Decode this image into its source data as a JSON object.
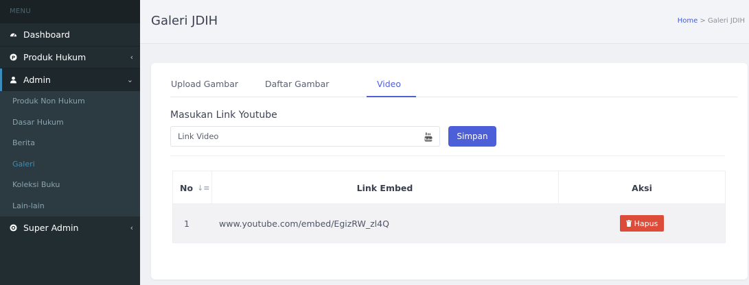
{
  "sidebar": {
    "menu_header": "MENU",
    "items": {
      "dashboard": {
        "label": "Dashboard",
        "icon": "dashboard-icon"
      },
      "produk_hukum": {
        "label": "Produk Hukum",
        "icon": "p-circle-icon"
      },
      "admin": {
        "label": "Admin",
        "icon": "user-icon"
      },
      "super_admin": {
        "label": "Super Admin",
        "icon": "dot-circle-icon"
      }
    },
    "admin_sub": [
      "Produk Non Hukum",
      "Dasar Hukum",
      "Berita",
      "Galeri",
      "Koleksi Buku",
      "Lain-lain"
    ],
    "active_sub": "Galeri"
  },
  "header": {
    "title": "Galeri JDIH",
    "breadcrumb_home": "Home",
    "breadcrumb_sep": " > ",
    "breadcrumb_current": "Galeri JDIH"
  },
  "tabs": [
    "Upload Gambar",
    "Daftar Gambar",
    "Video"
  ],
  "active_tab": "Video",
  "form": {
    "section_label": "Masukan Link Youtube",
    "input_placeholder": "Link Video",
    "input_icon": "youtube-icon",
    "submit_label": "Simpan"
  },
  "table": {
    "headers": [
      "No",
      "Link Embed",
      "Aksi"
    ],
    "rows": [
      {
        "no": "1",
        "link": "www.youtube.com/embed/EgizRW_zl4Q",
        "action": "Hapus"
      }
    ]
  },
  "colors": {
    "sidebar_bg": "#222d32",
    "accent": "#4d5fd8",
    "danger": "#dd4b39",
    "active_link": "#3c8dbc"
  }
}
